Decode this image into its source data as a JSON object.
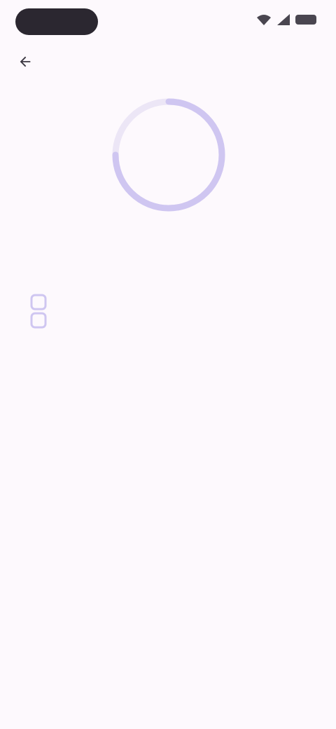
{
  "status_bar": {
    "time": "",
    "icons": [
      "wifi-icon",
      "signal-icon",
      "battery-icon"
    ]
  },
  "header": {
    "back_icon": "arrow-back-icon",
    "title": ""
  },
  "progress": {
    "value": 0.75,
    "percent_label": "",
    "track_color": "#ece6f6",
    "fill_color": "#cfc6f1"
  },
  "main": {
    "title": "",
    "steps": [
      {
        "icon": "checkbox-icon",
        "text": ""
      },
      {
        "icon": "checkbox-icon",
        "text": ""
      }
    ]
  },
  "colors": {
    "background": "#fdf9fd",
    "accent": "#cfc6f1",
    "time_pill": "#2b2730"
  }
}
